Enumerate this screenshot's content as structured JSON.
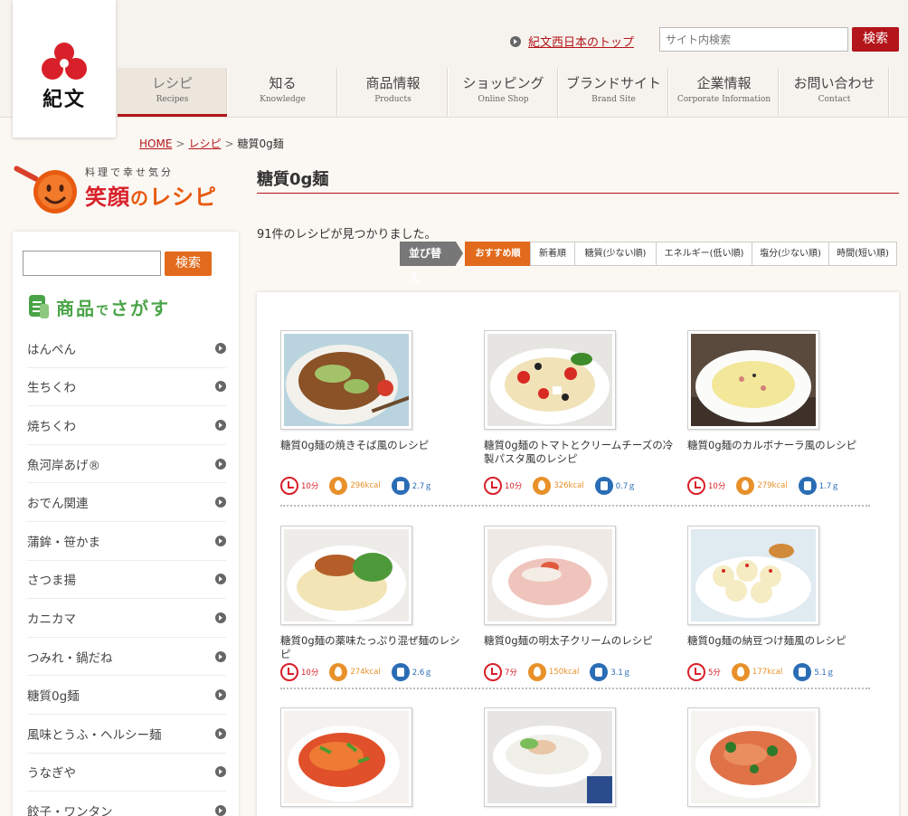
{
  "header": {
    "logo_text": "紀文",
    "top_link": "紀文西日本のトップ",
    "search_placeholder": "サイト内検索",
    "search_button": "検索",
    "nav": [
      {
        "jp": "レシピ",
        "en": "Recipes",
        "active": true
      },
      {
        "jp": "知る",
        "en": "Knowledge"
      },
      {
        "jp": "商品情報",
        "en": "Products"
      },
      {
        "jp": "ショッピング",
        "en": "Online Shop"
      },
      {
        "jp": "ブランドサイト",
        "en": "Brand Site"
      },
      {
        "jp": "企業情報",
        "en": "Corporate Information"
      },
      {
        "jp": "お問い合わせ",
        "en": "Contact"
      }
    ]
  },
  "breadcrumb": {
    "home": "HOME",
    "recipe": "レシピ",
    "current": "糖質0g麺"
  },
  "brand": {
    "small": "料理で幸せ気分",
    "big_a": "笑顔",
    "big_no": "の",
    "big_b": "レシピ"
  },
  "sidebar": {
    "search_button": "検索",
    "heading_a": "商品",
    "heading_de": "で",
    "heading_b": "さがす",
    "items": [
      "はんぺん",
      "生ちくわ",
      "焼ちくわ",
      "魚河岸あげ®",
      "おでん関連",
      "蒲鉾・笹かま",
      "さつま揚",
      "カニカマ",
      "つみれ・鍋だね",
      "糖質0g麺",
      "風味とうふ・ヘルシー麺",
      "うなぎや",
      "餃子・ワンタン"
    ]
  },
  "main": {
    "title": "糖質0g麺",
    "result_count": "91件のレシピが見つかりました。",
    "sort_label": "並び替え",
    "sort_options": [
      "おすすめ順",
      "新着順",
      "糖質(少ない順)",
      "エネルギー(低い順)",
      "塩分(少ない順)",
      "時間(短い順)"
    ],
    "recipes": [
      {
        "title": "糖質0g麺の焼きそば風のレシピ",
        "time": "10分",
        "kcal": "296kcal",
        "salt": "2.7ｇ"
      },
      {
        "title": "糖質0g麺のトマトとクリームチーズの冷製パスタ風のレシピ",
        "time": "10分",
        "kcal": "326kcal",
        "salt": "0.7ｇ"
      },
      {
        "title": "糖質0g麺のカルボナーラ風のレシピ",
        "time": "10分",
        "kcal": "279kcal",
        "salt": "1.7ｇ"
      },
      {
        "title": "糖質0g麺の薬味たっぷり混ぜ麺のレシピ",
        "time": "10分",
        "kcal": "274kcal",
        "salt": "2.6ｇ"
      },
      {
        "title": "糖質0g麺の明太子クリームのレシピ",
        "time": "7分",
        "kcal": "150kcal",
        "salt": "3.1ｇ"
      },
      {
        "title": "糖質0g麺の納豆つけ麺風のレシピ",
        "time": "5分",
        "kcal": "177kcal",
        "salt": "5.1ｇ"
      },
      {
        "title": ""
      },
      {
        "title": ""
      },
      {
        "title": ""
      }
    ]
  },
  "colors": {
    "brand_red": "#b3151a",
    "accent_orange": "#e26a1c",
    "green": "#4aa447"
  }
}
